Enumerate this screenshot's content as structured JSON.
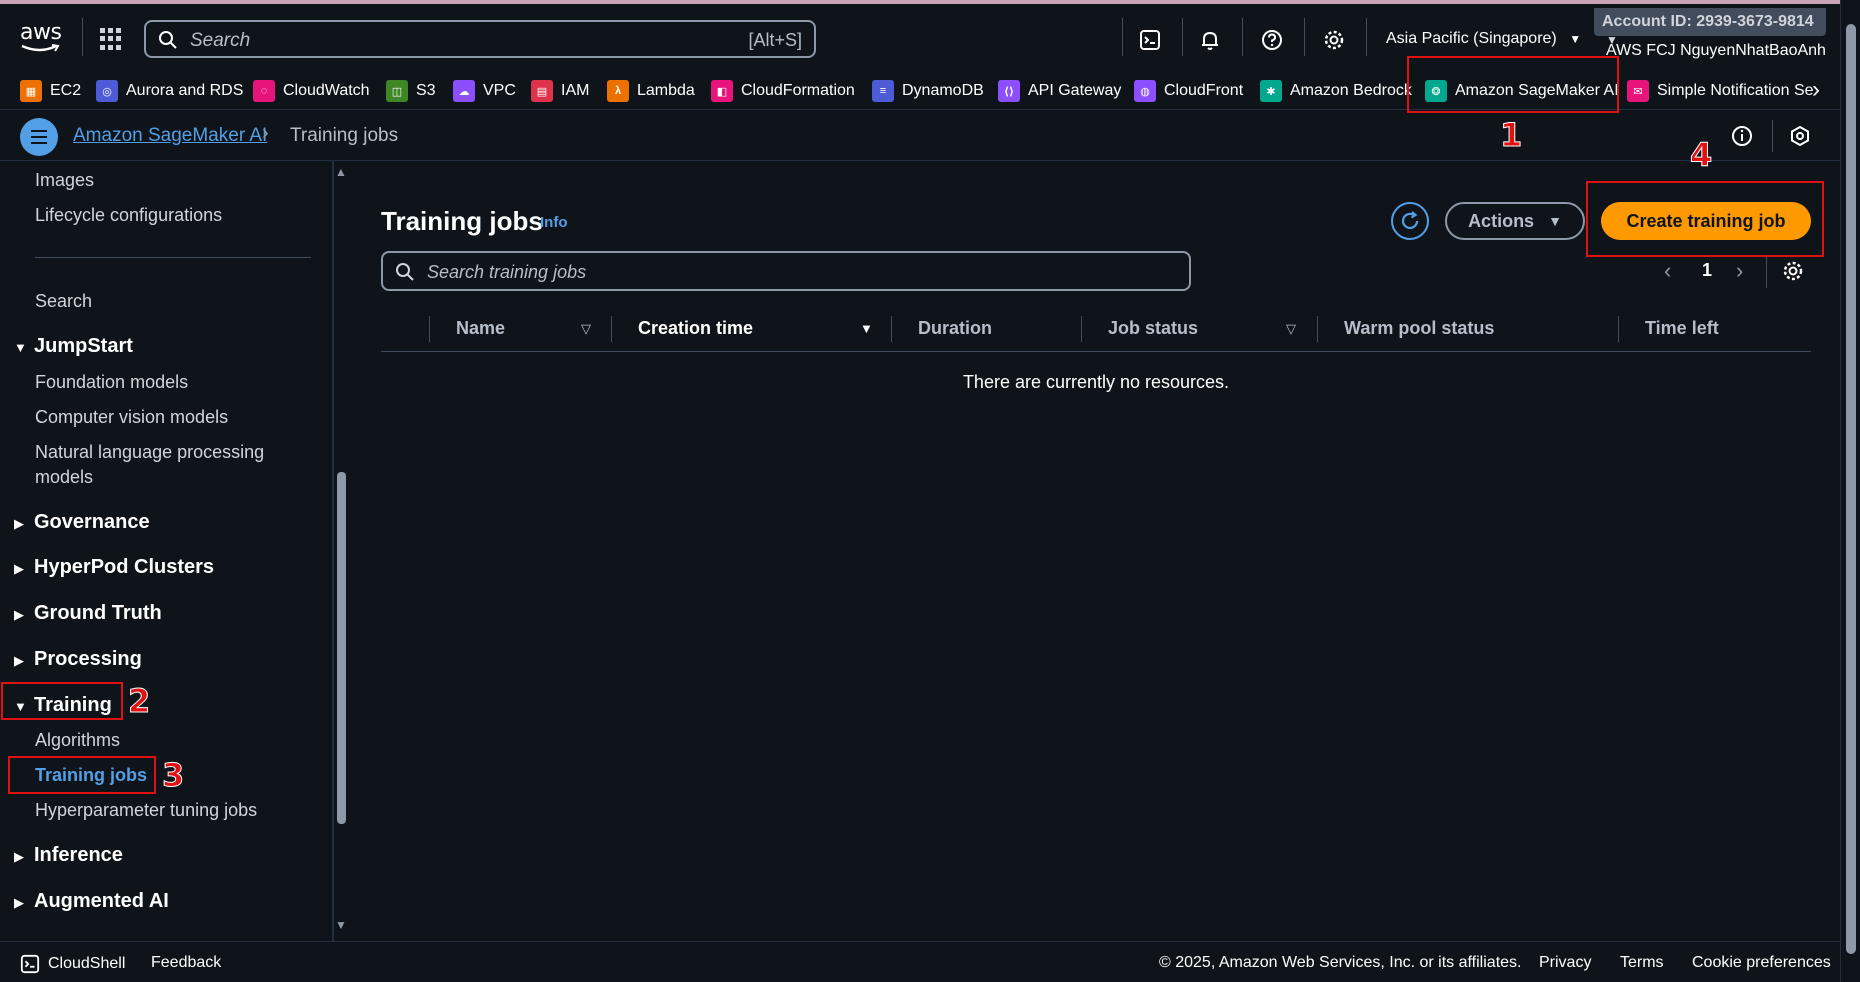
{
  "topbar": {
    "logo": "aws",
    "search_placeholder": "Search",
    "search_shortcut": "[Alt+S]",
    "region": "Asia Pacific (Singapore)",
    "account": "Account ID: 2939-3673-9814",
    "user": "AWS FCJ NguyenNhatBaoAnh"
  },
  "favorites": [
    {
      "label": "EC2",
      "color": "#ed7100"
    },
    {
      "label": "Aurora and RDS",
      "color": "#4d5bd6"
    },
    {
      "label": "CloudWatch",
      "color": "#e7157b"
    },
    {
      "label": "S3",
      "color": "#3f8624"
    },
    {
      "label": "VPC",
      "color": "#8c4fff"
    },
    {
      "label": "IAM",
      "color": "#dd344c"
    },
    {
      "label": "Lambda",
      "color": "#ed7100"
    },
    {
      "label": "CloudFormation",
      "color": "#e7157b"
    },
    {
      "label": "DynamoDB",
      "color": "#4d5bd6"
    },
    {
      "label": "API Gateway",
      "color": "#8c4fff"
    },
    {
      "label": "CloudFront",
      "color": "#8c4fff"
    },
    {
      "label": "Amazon Bedrock",
      "color": "#01a88d"
    },
    {
      "label": "Amazon SageMaker AI",
      "color": "#01a88d"
    },
    {
      "label": "Simple Notification Se",
      "color": "#e7157b"
    }
  ],
  "breadcrumb": {
    "service": "Amazon SageMaker AI",
    "current": "Training jobs"
  },
  "sidebar": {
    "top_items": [
      "Images",
      "Lifecycle configurations"
    ],
    "search": "Search",
    "jumpstart": {
      "label": "JumpStart",
      "items": [
        "Foundation models",
        "Computer vision models",
        "Natural language processing",
        "models"
      ]
    },
    "sections": [
      "Governance",
      "HyperPod Clusters",
      "Ground Truth",
      "Processing"
    ],
    "training": {
      "label": "Training",
      "items": [
        "Algorithms",
        "Training jobs",
        "Hyperparameter tuning jobs"
      ]
    },
    "bottom_sections": [
      "Inference",
      "Augmented AI"
    ]
  },
  "main": {
    "title": "Training jobs",
    "info": "Info",
    "actions_label": "Actions",
    "create_label": "Create training job",
    "search_placeholder": "Search training jobs",
    "page_number": "1",
    "columns": [
      "Name",
      "Creation time",
      "Duration",
      "Job status",
      "Warm pool status",
      "Time left"
    ],
    "empty_message": "There are currently no resources."
  },
  "footer": {
    "cloudshell": "CloudShell",
    "feedback": "Feedback",
    "copyright": "© 2025, Amazon Web Services, Inc. or its affiliates.",
    "privacy": "Privacy",
    "terms": "Terms",
    "cookies": "Cookie preferences"
  },
  "annotations": [
    "1",
    "2",
    "3",
    "4"
  ],
  "colors": {
    "accent": "#539fe5",
    "primary_button": "#ff9900",
    "annotation": "#e01111"
  }
}
